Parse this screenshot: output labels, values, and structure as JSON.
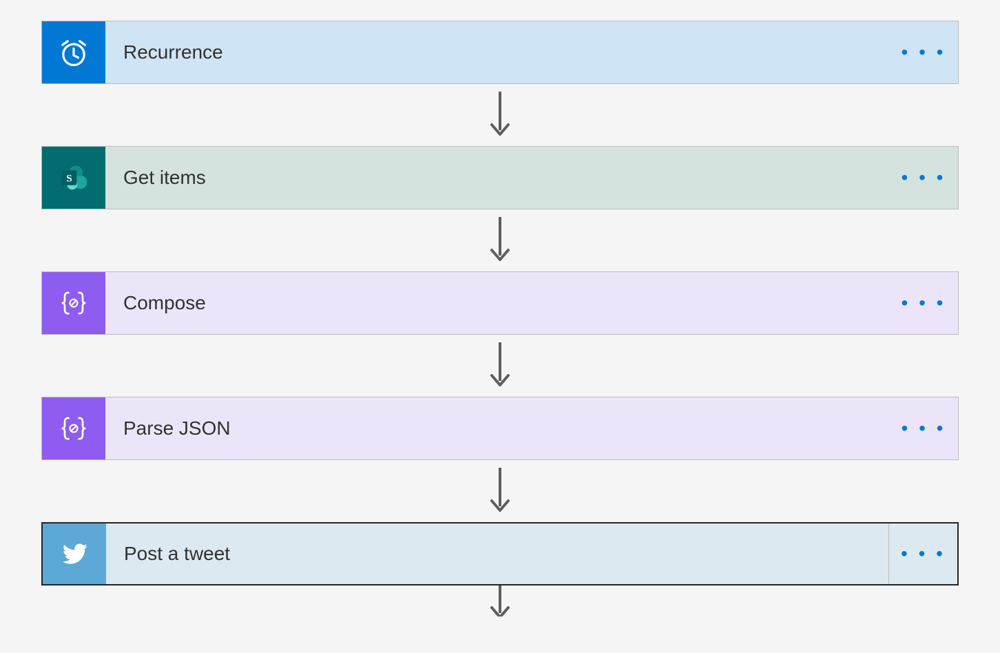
{
  "steps": [
    {
      "label": "Recurrence",
      "icon": "clock-icon",
      "icon_class": "recurrence-icon",
      "body_class": "recurrence-bg",
      "selected": false
    },
    {
      "label": "Get items",
      "icon": "sharepoint-icon",
      "icon_class": "sharepoint-icon",
      "body_class": "sharepoint-bg",
      "selected": false
    },
    {
      "label": "Compose",
      "icon": "braces-icon",
      "icon_class": "dataop-icon",
      "body_class": "dataop-bg",
      "selected": false
    },
    {
      "label": "Parse JSON",
      "icon": "braces-icon",
      "icon_class": "dataop-icon",
      "body_class": "dataop-bg",
      "selected": false
    },
    {
      "label": "Post a tweet",
      "icon": "twitter-icon",
      "icon_class": "twitter-icon",
      "body_class": "twitter-bg",
      "selected": true
    }
  ],
  "menu_glyph": "• • •"
}
